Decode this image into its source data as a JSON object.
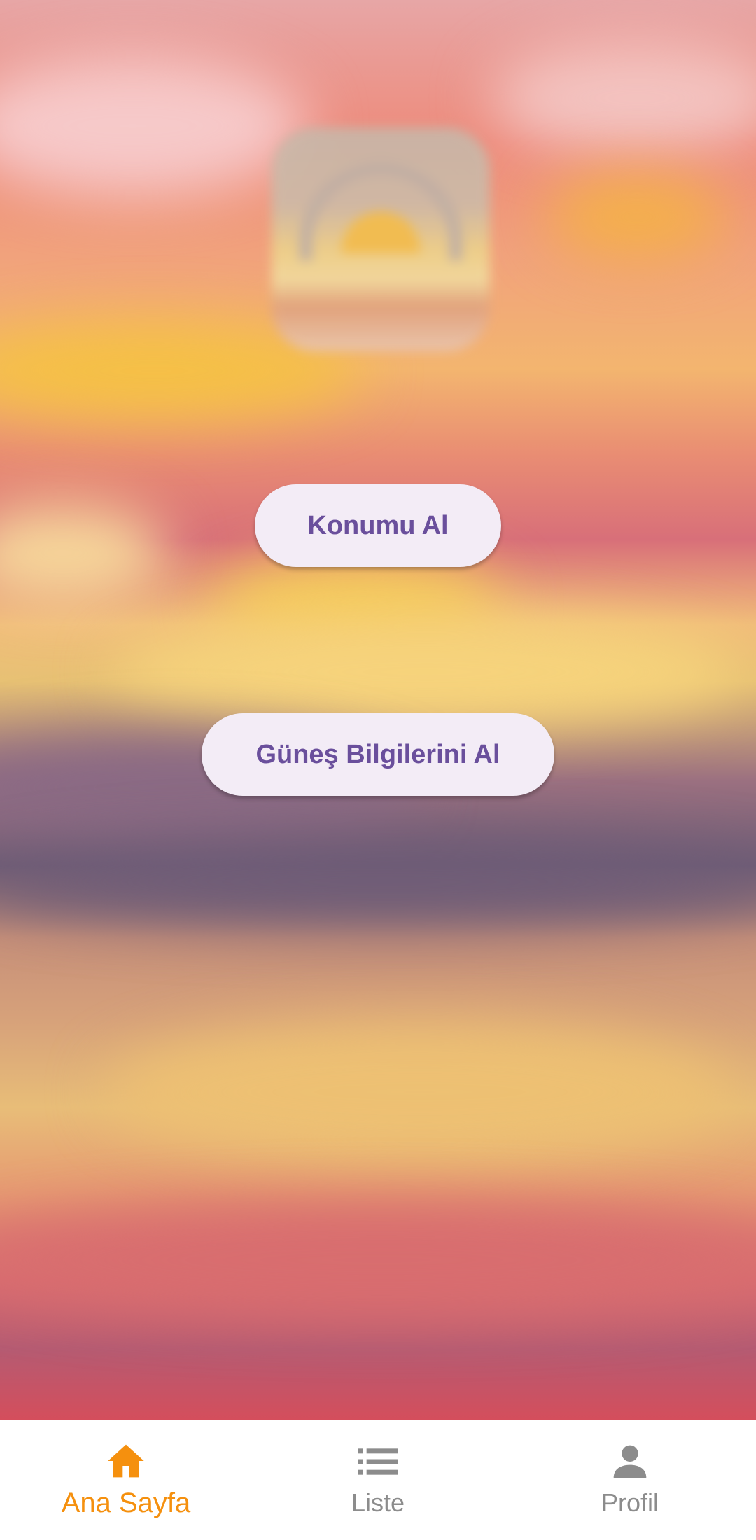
{
  "buttons": {
    "get_location": "Konumu Al",
    "get_sun_info": "Güneş Bilgilerini Al"
  },
  "bottom_nav": {
    "items": [
      {
        "label": "Ana Sayfa",
        "icon": "home-icon",
        "active": true
      },
      {
        "label": "Liste",
        "icon": "list-icon",
        "active": false
      },
      {
        "label": "Profil",
        "icon": "person-icon",
        "active": false
      }
    ]
  },
  "colors": {
    "accent": "#f5900e",
    "button_text": "#6a4f9c",
    "button_bg": "#f3ecf6",
    "nav_inactive": "#8c8c8c"
  }
}
